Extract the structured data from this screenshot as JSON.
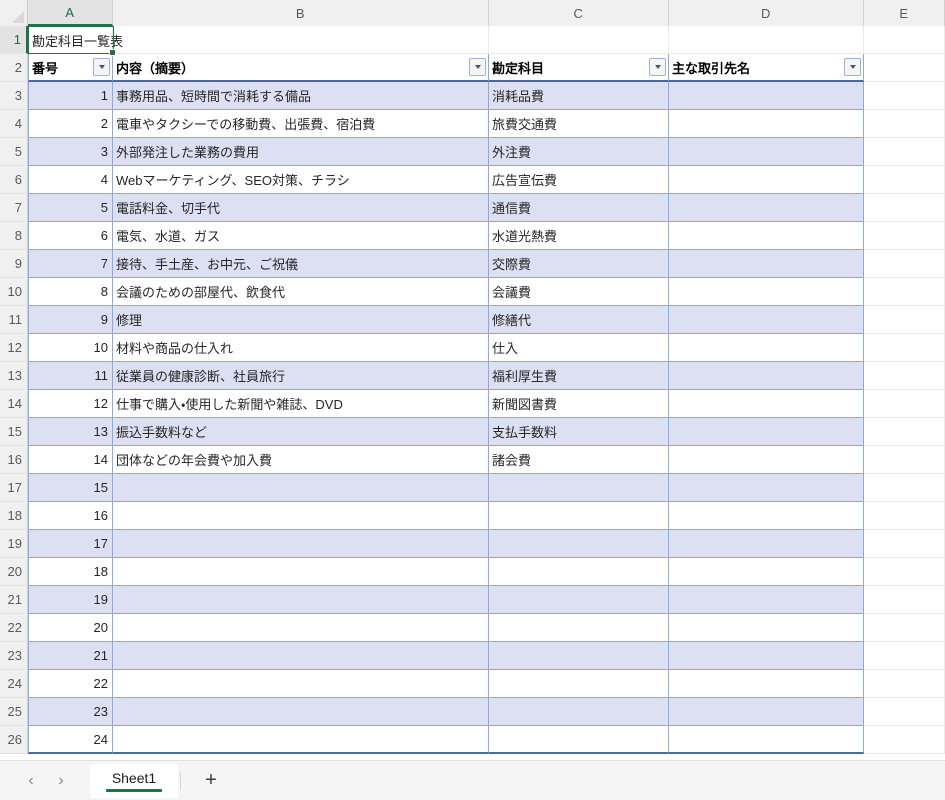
{
  "workbook": {
    "active_cell": "A1",
    "active_cell_value": "勘定科目一覧表",
    "active_column": "A",
    "active_row": "1"
  },
  "grid": {
    "columns": [
      {
        "letter": "A",
        "active": true
      },
      {
        "letter": "B",
        "active": false
      },
      {
        "letter": "C",
        "active": false
      },
      {
        "letter": "D",
        "active": false
      },
      {
        "letter": "E",
        "active": false
      }
    ],
    "row_numbers": [
      "1",
      "2",
      "3",
      "4",
      "5",
      "6",
      "7",
      "8",
      "9",
      "10",
      "11",
      "12",
      "13",
      "14",
      "15",
      "16",
      "17",
      "18",
      "19",
      "20",
      "21",
      "22",
      "23",
      "24",
      "25",
      "26"
    ]
  },
  "table": {
    "title_cell": "勘定科目一覧表",
    "headers": [
      "番号",
      "内容（摘要）",
      "勘定科目",
      "主な取引先名"
    ],
    "filter_icon": "filter-dropdown-icon",
    "rows": [
      {
        "no": "1",
        "desc": "事務用品、短時間で消耗する備品",
        "account": "消耗品費",
        "client": ""
      },
      {
        "no": "2",
        "desc": "電車やタクシーでの移動費、出張費、宿泊費",
        "account": "旅費交通費",
        "client": ""
      },
      {
        "no": "3",
        "desc": "外部発注した業務の費用",
        "account": "外注費",
        "client": ""
      },
      {
        "no": "4",
        "desc": "Webマーケティング、SEO対策、チラシ",
        "account": "広告宣伝費",
        "client": ""
      },
      {
        "no": "5",
        "desc": "電話料金、切手代",
        "account": "通信費",
        "client": ""
      },
      {
        "no": "6",
        "desc": "電気、水道、ガス",
        "account": "水道光熱費",
        "client": ""
      },
      {
        "no": "7",
        "desc": "接待、手土産、お中元、ご祝儀",
        "account": "交際費",
        "client": ""
      },
      {
        "no": "8",
        "desc": "会議のための部屋代、飲食代",
        "account": "会議費",
        "client": ""
      },
      {
        "no": "9",
        "desc": "修理",
        "account": "修繕代",
        "client": ""
      },
      {
        "no": "10",
        "desc": "材料や商品の仕入れ",
        "account": "仕入",
        "client": ""
      },
      {
        "no": "11",
        "desc": "従業員の健康診断、社員旅行",
        "account": "福利厚生費",
        "client": ""
      },
      {
        "no": "12",
        "desc": "仕事で購入・使用した新聞や雑誌、DVD",
        "account": "新聞図書費",
        "client": ""
      },
      {
        "no": "13",
        "desc": "振込手数料など",
        "account": "支払手数料",
        "client": ""
      },
      {
        "no": "14",
        "desc": "団体などの年会費や加入費",
        "account": "諸会費",
        "client": ""
      },
      {
        "no": "15",
        "desc": "",
        "account": "",
        "client": ""
      },
      {
        "no": "16",
        "desc": "",
        "account": "",
        "client": ""
      },
      {
        "no": "17",
        "desc": "",
        "account": "",
        "client": ""
      },
      {
        "no": "18",
        "desc": "",
        "account": "",
        "client": ""
      },
      {
        "no": "19",
        "desc": "",
        "account": "",
        "client": ""
      },
      {
        "no": "20",
        "desc": "",
        "account": "",
        "client": ""
      },
      {
        "no": "21",
        "desc": "",
        "account": "",
        "client": ""
      },
      {
        "no": "22",
        "desc": "",
        "account": "",
        "client": ""
      },
      {
        "no": "23",
        "desc": "",
        "account": "",
        "client": ""
      },
      {
        "no": "24",
        "desc": "",
        "account": "",
        "client": ""
      }
    ]
  },
  "tabbar": {
    "prev_icon": "chevron-left-icon",
    "next_icon": "chevron-right-icon",
    "sheets": [
      {
        "name": "Sheet1",
        "active": true
      }
    ],
    "add_sheet_icon": "plus-icon",
    "add_sheet_label": "+"
  },
  "colors": {
    "accent_green": "#217346",
    "table_border": "#8ea9db",
    "band_fill": "#dce0f2",
    "header_underline": "#4a66ac"
  }
}
